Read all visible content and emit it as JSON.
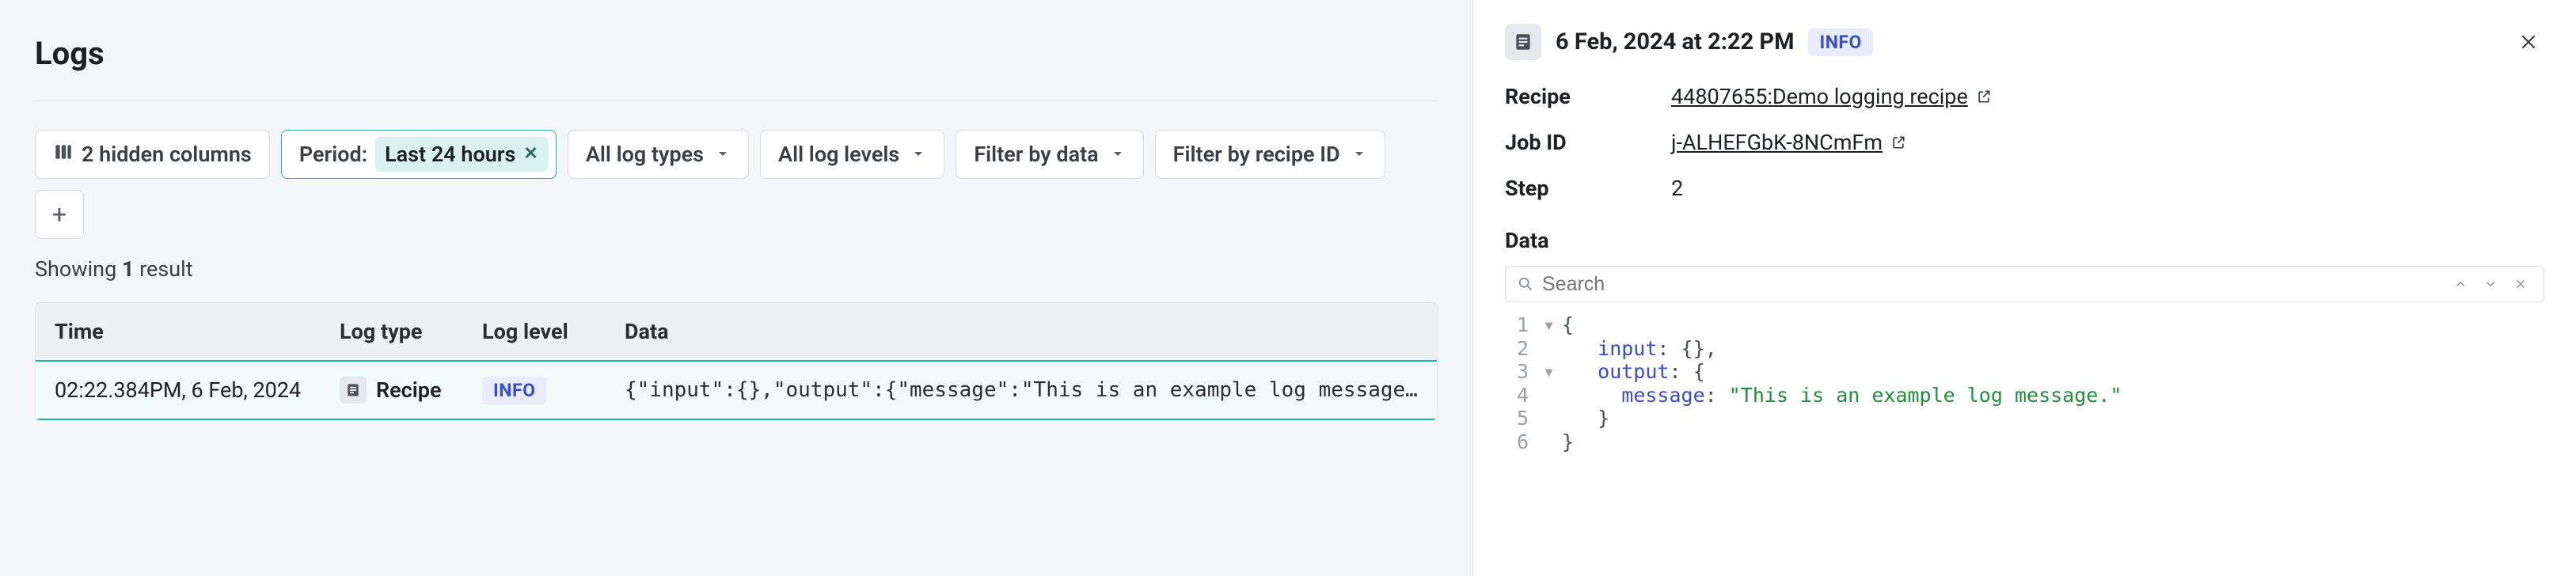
{
  "page": {
    "title": "Logs",
    "result_text_prefix": "Showing ",
    "result_count": "1",
    "result_text_suffix": " result"
  },
  "filters": {
    "hidden_columns": "2 hidden columns",
    "period_label": "Period:",
    "period_value": "Last 24 hours",
    "log_types": "All log types",
    "log_levels": "All log levels",
    "filter_data": "Filter by data",
    "filter_recipe": "Filter by recipe ID"
  },
  "table": {
    "headers": {
      "time": "Time",
      "logtype": "Log type",
      "loglevel": "Log level",
      "data": "Data"
    },
    "row": {
      "time": "02:22.384PM, 6 Feb, 2024",
      "logtype": "Recipe",
      "loglevel": "INFO",
      "data": "{\"input\":{},\"output\":{\"message\":\"This is an example log message.\"}}"
    }
  },
  "detail": {
    "title": "6 Feb, 2024 at 2:22 PM",
    "level": "INFO",
    "labels": {
      "recipe": "Recipe",
      "jobid": "Job ID",
      "step": "Step",
      "data": "Data"
    },
    "recipe": "44807655:Demo logging recipe",
    "jobid": "j-ALHEFGbK-8NCmFm",
    "step": "2",
    "search_placeholder": "Search",
    "code": {
      "l1": "{",
      "l2_key": "input",
      "l2_rest": ": {},",
      "l3_key": "output",
      "l3_rest": ": {",
      "l4_key": "message",
      "l4_colon": ": ",
      "l4_str": "\"This is an example log message.\"",
      "l5": "}",
      "l6": "}"
    }
  }
}
